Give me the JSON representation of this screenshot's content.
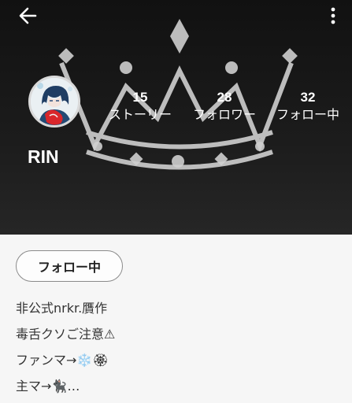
{
  "header": {
    "back_icon": "arrow-left-icon",
    "menu_icon": "more-vertical-icon",
    "background_motif": "crown-outline"
  },
  "profile": {
    "name": "RIN",
    "stats": [
      {
        "key": "stories",
        "value": "15",
        "label": "ストーリー"
      },
      {
        "key": "followers",
        "value": "28",
        "label": "フォロワー"
      },
      {
        "key": "following",
        "value": "32",
        "label": "フォロー中"
      }
    ]
  },
  "actions": {
    "follow_label": "フォロー中"
  },
  "bio": {
    "lines": [
      "非公式nrkr.贋作",
      "毒舌クソご注意⚠",
      "ファンマ→❄️🏵",
      "主マ→🐈‍⬛…"
    ]
  },
  "colors": {
    "header_bg": "#1a1a1a",
    "motif": "#cfcfcf",
    "body_bg": "#f6f6f6",
    "text": "#333333"
  }
}
